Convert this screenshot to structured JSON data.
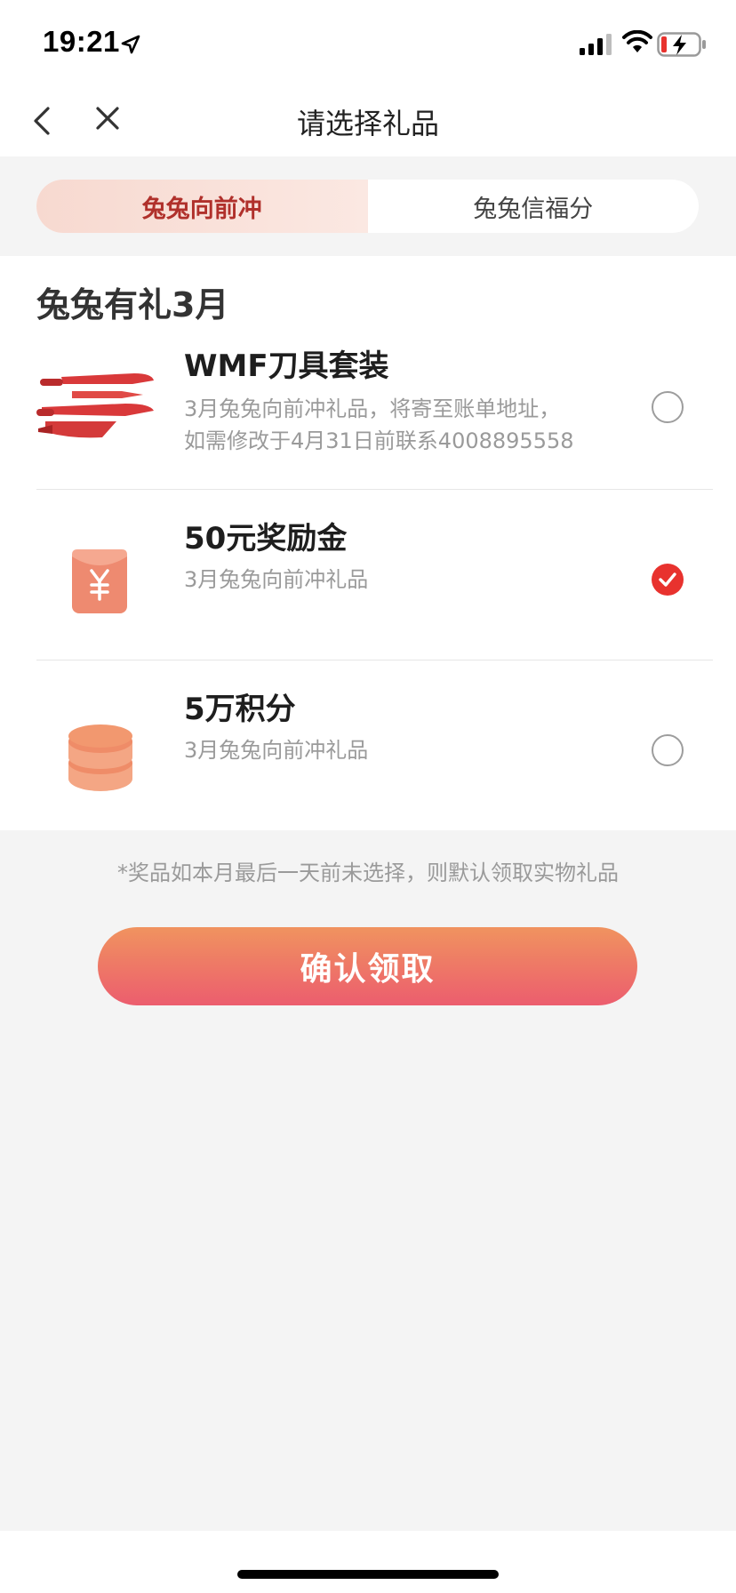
{
  "status_bar": {
    "time": "19:21"
  },
  "navbar": {
    "title": "请选择礼品"
  },
  "tabs": [
    {
      "label": "兔兔向前冲",
      "active": true
    },
    {
      "label": "兔兔信福分",
      "active": false
    }
  ],
  "section": {
    "title": "兔兔有礼3月"
  },
  "gifts": [
    {
      "name": "WMF刀具套装",
      "desc_line1": "3月兔兔向前冲礼品，将寄至账单地址，",
      "desc_line2": "如需修改于4月31日前联系4008895558",
      "selected": false,
      "icon": "knife-set-icon"
    },
    {
      "name": "50元奖励金",
      "desc_line1": "3月兔兔向前冲礼品",
      "selected": true,
      "icon": "red-envelope-icon"
    },
    {
      "name": "5万积分",
      "desc_line1": "3月兔兔向前冲礼品",
      "selected": false,
      "icon": "coin-stack-icon"
    }
  ],
  "notice": "*奖品如本月最后一天前未选择，则默认领取实物礼品",
  "confirm_label": "确认领取",
  "colors": {
    "accent_red": "#e8322e",
    "tab_active_text": "#b0302b",
    "button_gradient_top": "#f0935f",
    "button_gradient_bottom": "#ec5d6e"
  }
}
